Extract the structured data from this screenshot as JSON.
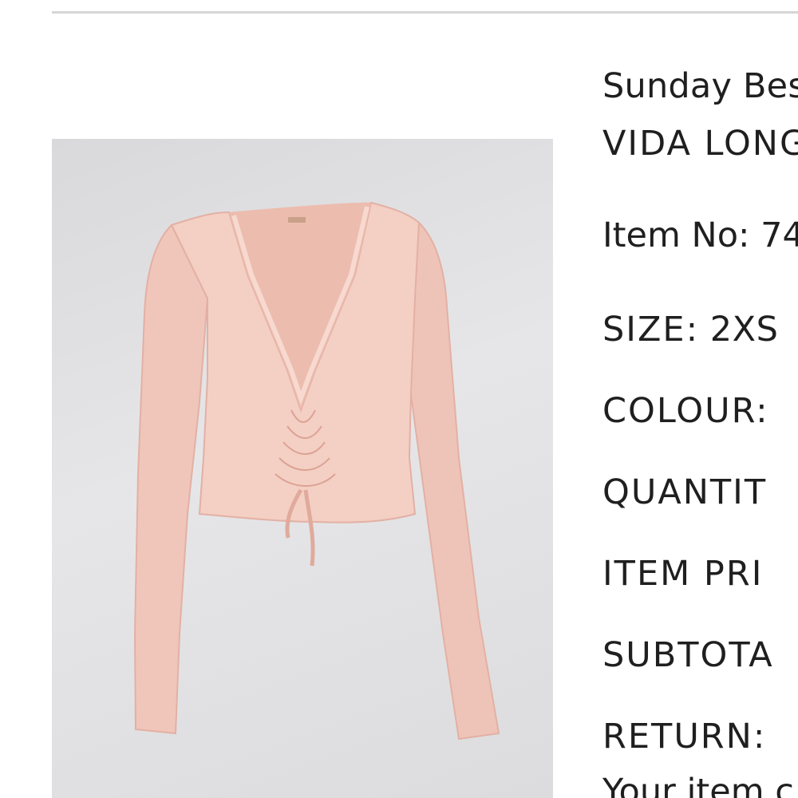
{
  "product": {
    "brand": "Sunday Best",
    "name": "VIDA LONG SLEEVE",
    "image_alt": "Pink ruched long sleeve crop top",
    "colors": {
      "garment": "#f2cbc0",
      "background": "#dedee0"
    }
  },
  "details": {
    "item_no": "Item No: 74",
    "size_label": "SIZE:",
    "size_value": "2XS",
    "colour_label": "COLOUR:",
    "quantity_label": "QUANTIT",
    "item_price_label": "ITEM PRI",
    "subtotal_label": "SUBTOTA",
    "return_label": "RETURN:",
    "return_note": "Your item c"
  }
}
